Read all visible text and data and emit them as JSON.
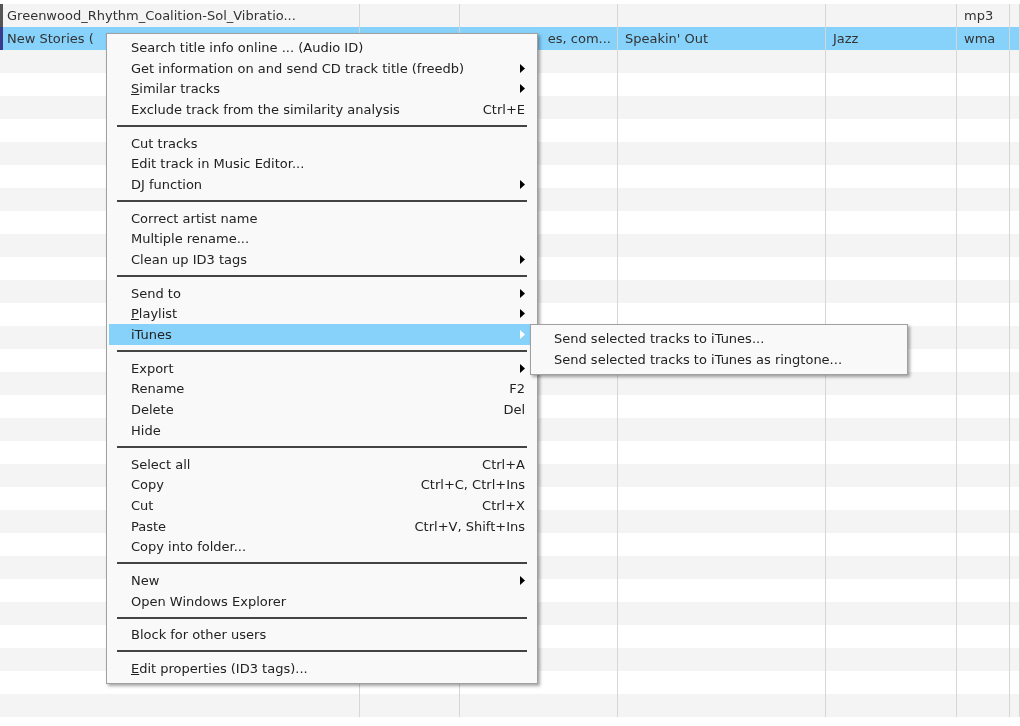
{
  "table": {
    "rows": [
      {
        "selected": false,
        "cells": [
          "Greenwood_Rhythm_Coalition-Sol_Vibratio...",
          "",
          "",
          "",
          "",
          "mp3",
          ""
        ]
      },
      {
        "selected": true,
        "cells": [
          "New Stories (",
          "",
          "es, com...",
          "Speakin' Out",
          "Jazz",
          "wma",
          ""
        ]
      }
    ]
  },
  "context_menu": {
    "groups": [
      [
        {
          "label": "Search title info online ... (Audio ID)",
          "selected": false,
          "submenu": false,
          "mnemonic": false
        },
        {
          "label": "Get information on and send CD track title (freedb)",
          "selected": false,
          "submenu": true,
          "mnemonic": false
        },
        {
          "label": "Similar tracks",
          "selected": false,
          "submenu": true,
          "mnemonic": true
        },
        {
          "label": "Exclude track from the similarity analysis",
          "shortcut": "Ctrl+E",
          "selected": false,
          "submenu": false,
          "mnemonic": false
        }
      ],
      [
        {
          "label": "Cut tracks",
          "selected": false,
          "submenu": false,
          "mnemonic": false
        },
        {
          "label": "Edit track in Music Editor...",
          "selected": false,
          "submenu": false,
          "mnemonic": false
        },
        {
          "label": "DJ function",
          "selected": false,
          "submenu": true,
          "mnemonic": false
        }
      ],
      [
        {
          "label": "Correct artist name",
          "selected": false,
          "submenu": false,
          "mnemonic": false
        },
        {
          "label": "Multiple rename...",
          "selected": false,
          "submenu": false,
          "mnemonic": false
        },
        {
          "label": "Clean up ID3 tags",
          "selected": false,
          "submenu": true,
          "mnemonic": false
        }
      ],
      [
        {
          "label": "Send to",
          "selected": false,
          "submenu": true,
          "mnemonic": false
        },
        {
          "label": "Playlist",
          "selected": false,
          "submenu": true,
          "mnemonic": true
        },
        {
          "label": "iTunes",
          "selected": true,
          "submenu": true,
          "mnemonic": false
        }
      ],
      [
        {
          "label": "Export",
          "selected": false,
          "submenu": true,
          "mnemonic": false
        },
        {
          "label": "Rename",
          "shortcut": "F2",
          "selected": false,
          "submenu": false,
          "mnemonic": false
        },
        {
          "label": "Delete",
          "shortcut": "Del",
          "selected": false,
          "submenu": false,
          "mnemonic": false
        },
        {
          "label": "Hide",
          "selected": false,
          "submenu": false,
          "mnemonic": false
        }
      ],
      [
        {
          "label": "Select all",
          "shortcut": "Ctrl+A",
          "selected": false,
          "submenu": false,
          "mnemonic": false
        },
        {
          "label": "Copy",
          "shortcut": "Ctrl+C, Ctrl+Ins",
          "selected": false,
          "submenu": false,
          "mnemonic": false
        },
        {
          "label": "Cut",
          "shortcut": "Ctrl+X",
          "selected": false,
          "submenu": false,
          "mnemonic": false
        },
        {
          "label": "Paste",
          "shortcut": "Ctrl+V, Shift+Ins",
          "selected": false,
          "submenu": false,
          "mnemonic": false
        },
        {
          "label": "Copy into folder...",
          "selected": false,
          "submenu": false,
          "mnemonic": false
        }
      ],
      [
        {
          "label": "New",
          "selected": false,
          "submenu": true,
          "mnemonic": false
        },
        {
          "label": "Open Windows Explorer",
          "selected": false,
          "submenu": false,
          "mnemonic": false
        }
      ],
      [
        {
          "label": "Block for other users",
          "selected": false,
          "submenu": false,
          "mnemonic": false
        }
      ],
      [
        {
          "label": "Edit properties (ID3 tags)...",
          "selected": false,
          "submenu": false,
          "mnemonic": true
        }
      ]
    ]
  },
  "submenu": {
    "items": [
      {
        "label": "Send selected tracks to iTunes...",
        "selected": false
      },
      {
        "label": "Send selected tracks to iTunes as ringtone...",
        "selected": false
      }
    ]
  }
}
